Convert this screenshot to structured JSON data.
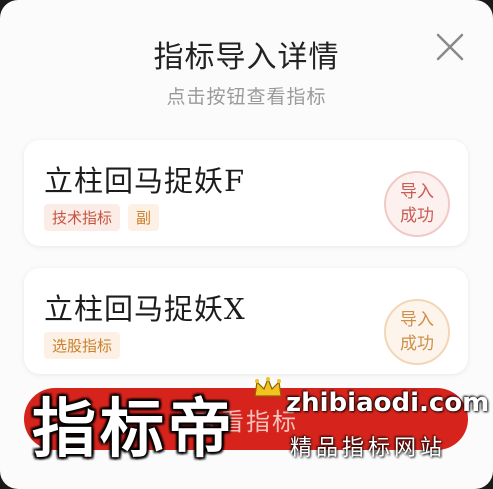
{
  "dialog": {
    "title": "指标导入详情",
    "subtitle": "点击按钮查看指标",
    "close_icon": "close-icon"
  },
  "cards": [
    {
      "name": "立柱回马捉妖F",
      "tags": [
        "技术指标",
        "副"
      ],
      "status": [
        "导入",
        "成功"
      ],
      "accent": "#c95d55"
    },
    {
      "name": "立柱回马捉妖X",
      "tags": [
        "选股指标"
      ],
      "status": [
        "导入",
        "成功"
      ],
      "accent": "#cf8f4c"
    }
  ],
  "bottom_button": {
    "label": "查看指标",
    "color": "#d6241d"
  },
  "watermark": {
    "brand": "指标帝",
    "site": "zhibiaodi.com",
    "slogan": "精品指标网站",
    "crown_icon": "crown-icon"
  }
}
